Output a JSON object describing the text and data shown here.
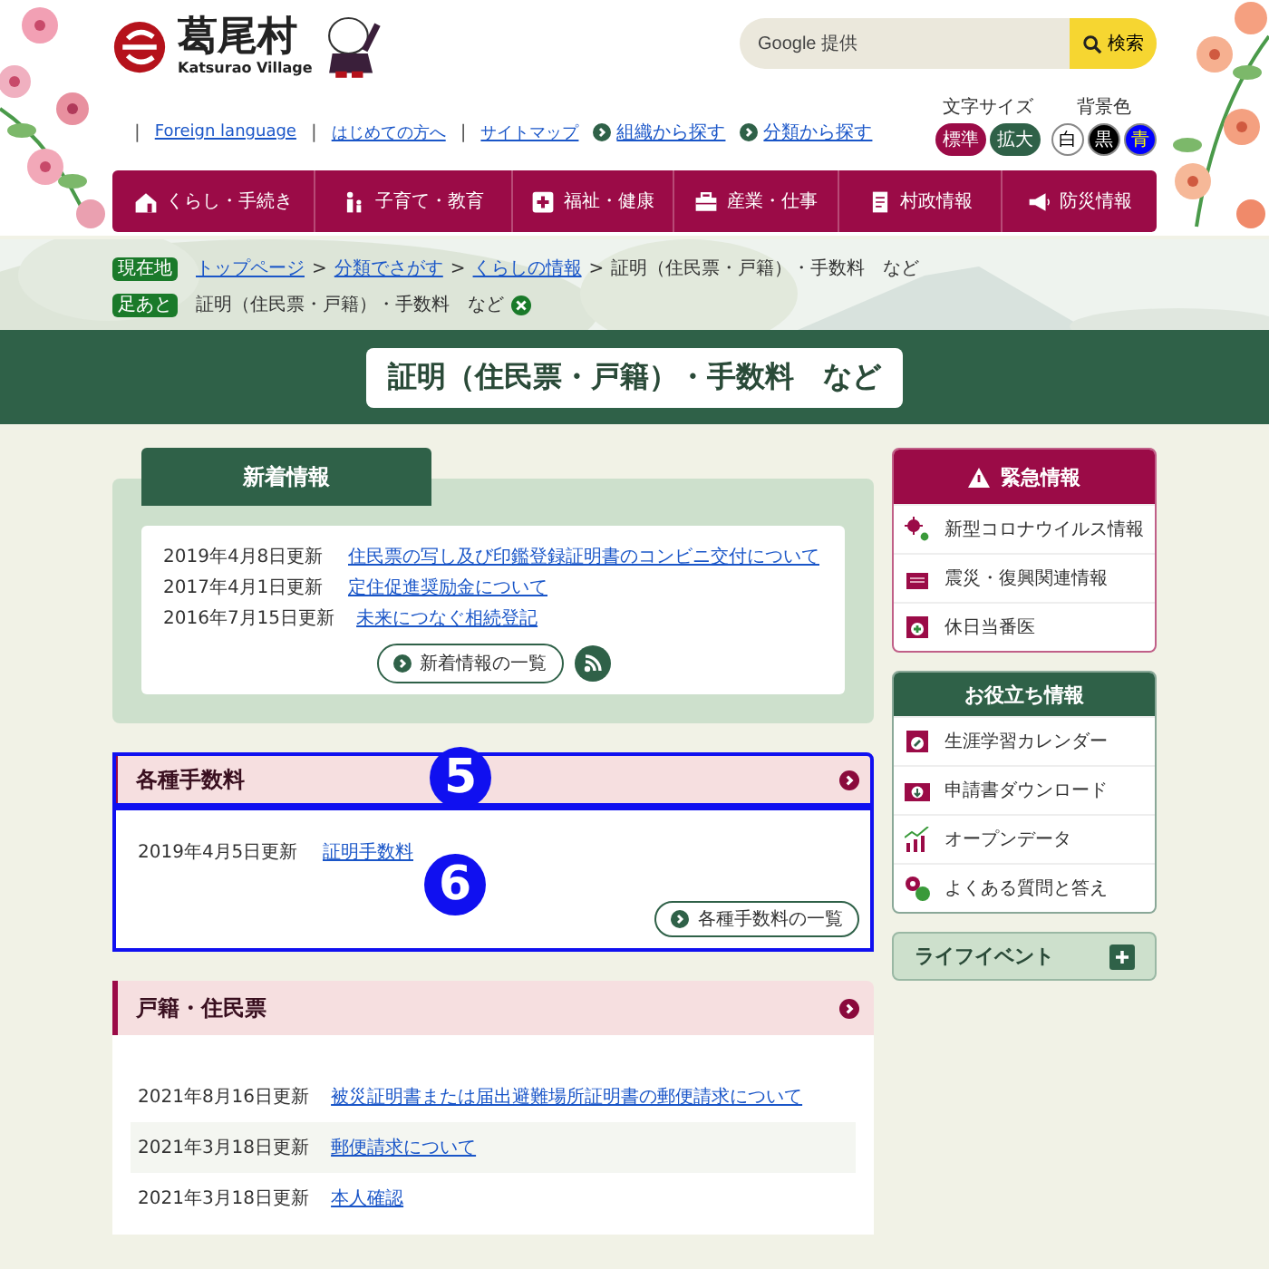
{
  "header": {
    "logo_name": "葛尾村",
    "logo_sub": "Katsurao Village",
    "search": {
      "placeholder": "Google 提供",
      "button": "検索"
    }
  },
  "utility_links": [
    {
      "label": "Foreign language",
      "kind": "plain"
    },
    {
      "label": "はじめての方へ",
      "kind": "plain"
    },
    {
      "label": "サイトマップ",
      "kind": "plain"
    },
    {
      "label": "組織から探す",
      "kind": "arrow"
    },
    {
      "label": "分類から探す",
      "kind": "arrow"
    }
  ],
  "separator": "|",
  "font_size": {
    "label": "文字サイズ",
    "options": [
      {
        "label": "標準",
        "color": "#9b0b47"
      },
      {
        "label": "拡大",
        "color": "#2f6148"
      }
    ]
  },
  "background_color": {
    "label": "背景色",
    "options": [
      {
        "label": "白",
        "color": "#ffffff"
      },
      {
        "label": "黒",
        "color": "#000000"
      },
      {
        "label": "青",
        "color": "#0000ff"
      }
    ]
  },
  "nav": [
    "くらし・手続き",
    "子育て・教育",
    "福祉・健康",
    "産業・仕事",
    "村政情報",
    "防災情報"
  ],
  "breadcrumb": {
    "badge": "現在地",
    "separator": ">",
    "links": [
      "トップページ",
      "分類でさがす",
      "くらしの情報"
    ],
    "current": "証明（住民票・戸籍）・手数料　など"
  },
  "footprint": {
    "badge": "足あと",
    "label": "証明（住民票・戸籍）・手数料　など"
  },
  "page_title": "証明（住民票・戸籍）・手数料　など",
  "news": {
    "title": "新着情報",
    "items": [
      {
        "date": "2019年4月8日更新",
        "title": "住民票の写し及び印鑑登録証明書のコンビニ交付について"
      },
      {
        "date": "2017年4月1日更新",
        "title": "定住促進奨励金について"
      },
      {
        "date": "2016年7月15日更新",
        "title": "未来につなぐ相続登記"
      }
    ],
    "more": "新着情報の一覧"
  },
  "sections": [
    {
      "title": "各種手数料",
      "header_annotation": "5",
      "body_annotation": "6",
      "items": [
        {
          "date": "2019年4月5日更新",
          "title": "証明手数料"
        }
      ],
      "more": "各種手数料の一覧"
    },
    {
      "title": "戸籍・住民票",
      "items": [
        {
          "date": "2021年8月16日更新",
          "title": "被災証明書または届出避難場所証明書の郵便請求について"
        },
        {
          "date": "2021年3月18日更新",
          "title": "郵便請求について"
        },
        {
          "date": "2021年3月18日更新",
          "title": "本人確認"
        }
      ]
    }
  ],
  "emergency": {
    "title": "緊急情報",
    "items": [
      "新型コロナウイルス情報",
      "震災・復興関連情報",
      "休日当番医"
    ]
  },
  "useful": {
    "title": "お役立ち情報",
    "items": [
      "生涯学習カレンダー",
      "申請書ダウンロード",
      "オープンデータ",
      "よくある質問と答え"
    ]
  },
  "life_event": "ライフイベント"
}
